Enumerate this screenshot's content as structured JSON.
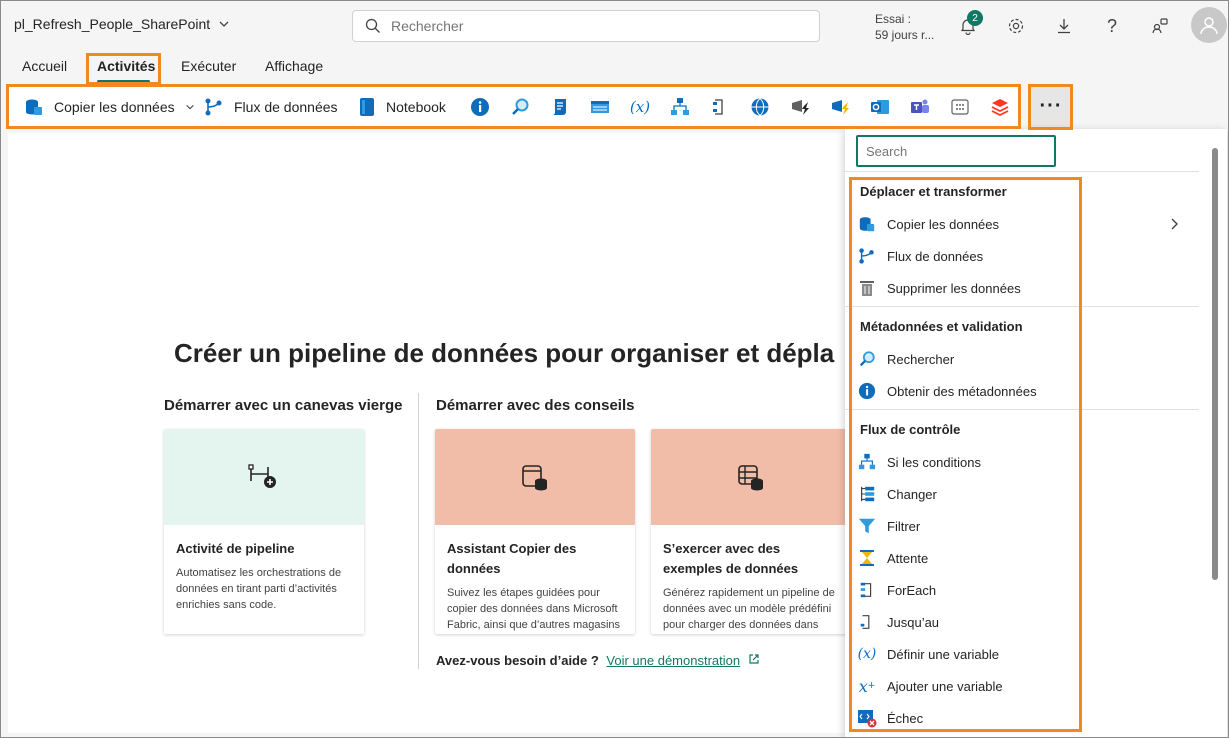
{
  "app": {
    "title": "pl_Refresh_People_SharePoint"
  },
  "search": {
    "placeholder": "Rechercher"
  },
  "trial": {
    "line1": "Essai :",
    "line2": "59 jours r..."
  },
  "notifications": {
    "count": "2"
  },
  "tabs": [
    {
      "label": "Accueil"
    },
    {
      "label": "Activités"
    },
    {
      "label": "Exécuter"
    },
    {
      "label": "Affichage"
    }
  ],
  "ribbon": {
    "copy_data": "Copier les données",
    "dataflow": "Flux de données",
    "notebook": "Notebook",
    "more": "···"
  },
  "canvas": {
    "heading": "Créer un pipeline de données pour organiser et dépla",
    "blank_section": "Démarrer avec un canevas vierge",
    "guided_section": "Démarrer avec des conseils",
    "cards": [
      {
        "title": "Activité de pipeline",
        "desc": "Automatisez les orchestrations de données en tirant parti d’activités enrichies sans code."
      },
      {
        "title": "Assistant Copier des données",
        "desc": "Suivez les étapes guidées pour copier des données dans Microsoft Fabric, ainsi que d’autres magasins de données."
      },
      {
        "title": "S’exercer avec des exemples de données",
        "desc": "Générez rapidement un pipeline de données avec un modèle prédéfini pour charger des données dans Lakehouse."
      }
    ],
    "help_question": "Avez-vous besoin d’aide ?",
    "help_link": "Voir une démonstration"
  },
  "panel": {
    "search_placeholder": "Search",
    "groups": [
      {
        "title": "Déplacer et transformer",
        "items": [
          "Copier les données",
          "Flux de données",
          "Supprimer les données"
        ]
      },
      {
        "title": "Métadonnées et validation",
        "items": [
          "Rechercher",
          "Obtenir des métadonnées"
        ]
      },
      {
        "title": "Flux de contrôle",
        "items": [
          "Si les conditions",
          "Changer",
          "Filtrer",
          "Attente",
          "ForEach",
          "Jusqu’au",
          "Définir une variable",
          "Ajouter une variable",
          "Échec"
        ]
      }
    ]
  },
  "colors": {
    "accent": "#117865",
    "highlight": "#f08a1e"
  }
}
